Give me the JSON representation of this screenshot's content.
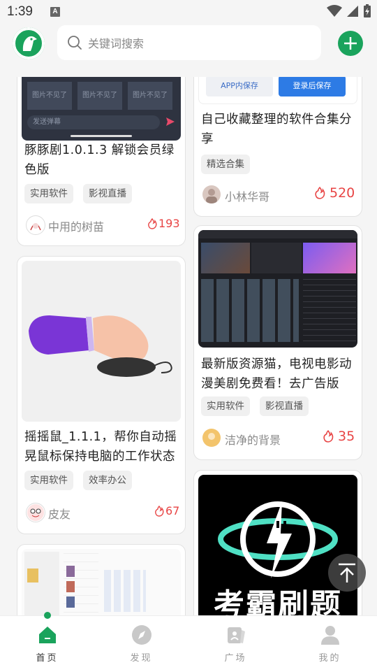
{
  "status_bar": {
    "time": "1:39",
    "notification_letter": "A"
  },
  "search": {
    "placeholder": "关键词搜索"
  },
  "top_left_card": {
    "screenshot_caption": "发送弹幕",
    "placeholder_texts": [
      "图片不见了",
      "图片不见了",
      "图片不见了"
    ]
  },
  "top_right_card": {
    "btn_app_save": "APP内保存",
    "btn_login_save": "登录后保存"
  },
  "cards": [
    {
      "title": "豚豚剧1.0.1.3 解锁会员绿色版",
      "tags": [
        "实用软件",
        "影视直播"
      ],
      "author": "中用的树苗",
      "likes": "193"
    },
    {
      "title": "自己收藏整理的软件合集分享",
      "tags": [
        "精选合集"
      ],
      "author": "小林华哥",
      "likes": "520"
    },
    {
      "title": "最新版资源猫，电视电影动漫美剧免费看！去广告版",
      "tags": [
        "实用软件",
        "影视直播"
      ],
      "author": "洁净的背景",
      "likes": "35"
    },
    {
      "title": "摇摇鼠_1.1.1，帮你自动摇晃鼠标保持电脑的工作状态",
      "tags": [
        "实用软件",
        "效率办公"
      ],
      "author": "皮友",
      "likes": "67"
    },
    {
      "title": "",
      "image_text": "考霸刷题"
    }
  ],
  "tabs": [
    {
      "label": "首页",
      "icon": "home-icon",
      "active": true
    },
    {
      "label": "发现",
      "icon": "compass-icon",
      "active": false
    },
    {
      "label": "广场",
      "icon": "square-icon",
      "active": false
    },
    {
      "label": "我的",
      "icon": "profile-icon",
      "active": false
    }
  ],
  "colors": {
    "brand_green": "#1aa35c",
    "like_red": "#e84545",
    "login_blue": "#2d7be5"
  }
}
